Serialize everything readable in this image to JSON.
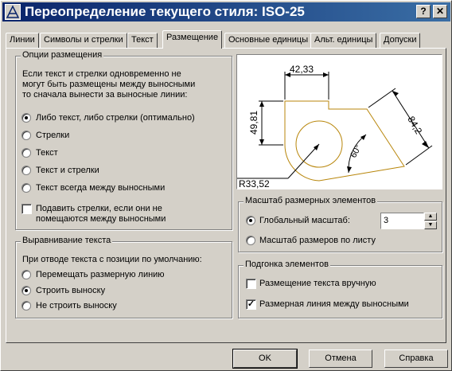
{
  "window": {
    "title": "Переопределение текущего стиля: ISO-25",
    "help_label": "?",
    "close_label": "✕"
  },
  "tabs": [
    {
      "label": "Линии"
    },
    {
      "label": "Символы и стрелки"
    },
    {
      "label": "Текст"
    },
    {
      "label": "Размещение"
    },
    {
      "label": "Основные единицы"
    },
    {
      "label": "Альт. единицы"
    },
    {
      "label": "Допуски"
    }
  ],
  "placement_options": {
    "title": "Опции размещения",
    "description": [
      "Если текст и стрелки одновременно не",
      "могут быть размещены между выносными",
      "то сначала вынести за выносные линии:"
    ],
    "options": [
      {
        "label": "Либо текст, либо стрелки (оптимально)",
        "selected": true
      },
      {
        "label": "Стрелки",
        "selected": false
      },
      {
        "label": "Текст",
        "selected": false
      },
      {
        "label": "Текст и стрелки",
        "selected": false
      },
      {
        "label": "Текст всегда между выносными",
        "selected": false
      }
    ],
    "suppress_arrows": {
      "line1": "Подавить стрелки, если они не",
      "line2": "помещаются между выносными",
      "checked": false
    }
  },
  "text_alignment": {
    "title": "Выравнивание текста",
    "description": "При отводе текста с позиции по умолчанию:",
    "options": [
      {
        "label": "Перемещать размерную линию",
        "selected": false
      },
      {
        "label": "Строить выноску",
        "selected": true
      },
      {
        "label": "Не строить выноску",
        "selected": false
      }
    ]
  },
  "preview": {
    "dim_horizontal": "42,33",
    "dim_vertical": "49,81",
    "dim_aligned": "84,2",
    "dim_angle": "60°",
    "dim_radius": "R33,52"
  },
  "scale": {
    "title": "Масштаб размерных элементов",
    "global_label": "Глобальный масштаб:",
    "global_selected": true,
    "global_value": "3",
    "layout_label": "Масштаб размеров по листу",
    "layout_selected": false
  },
  "fine_tuning": {
    "title": "Подгонка элементов",
    "manual_text": {
      "label": "Размещение текста вручную",
      "checked": false
    },
    "dim_line_between": {
      "label": "Размерная линия между выносными",
      "checked": true
    }
  },
  "buttons": {
    "ok": "OK",
    "cancel": "Отмена",
    "help": "Справка"
  },
  "colors": {
    "title_start": "#0a246a",
    "title_end": "#3a6ea5",
    "face": "#d4d0c8",
    "part_outline": "#b8860b"
  }
}
